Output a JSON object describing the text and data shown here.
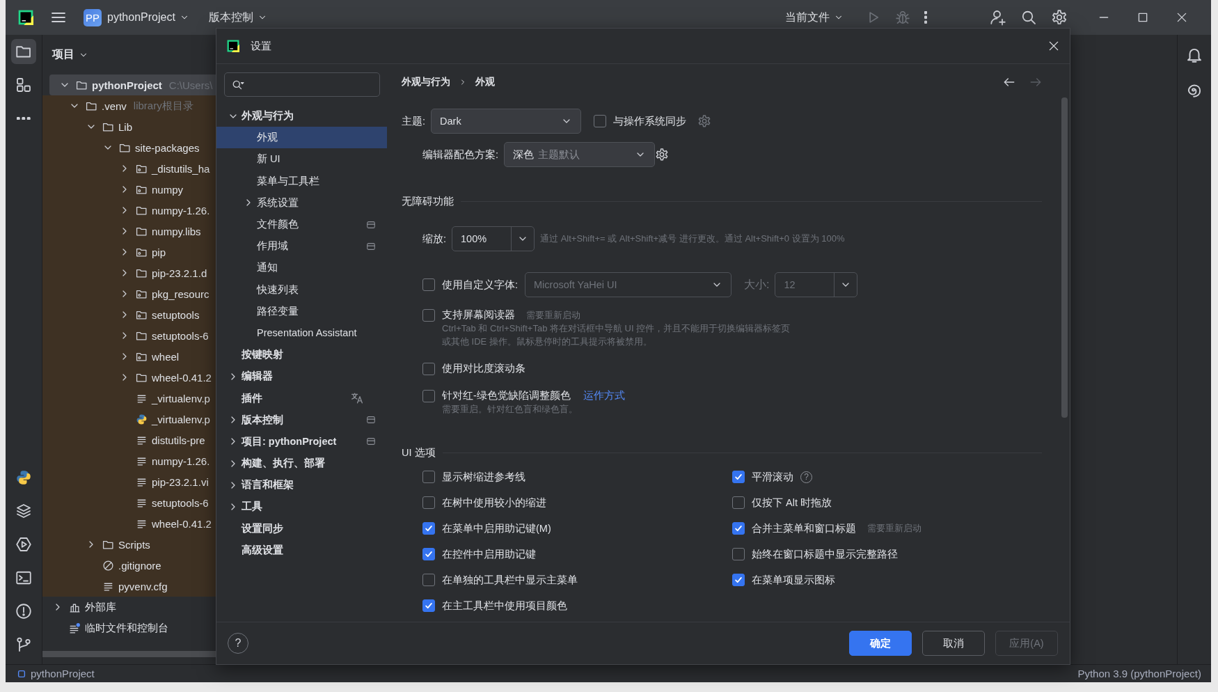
{
  "title_bar": {
    "project_badge": "PP",
    "project": "pythonProject",
    "vcs": "版本控制",
    "run_config": "当前文件",
    "run_disabled": true
  },
  "tool_strip": [
    {
      "kind": "folder",
      "selected": true
    },
    {
      "kind": "structure",
      "selected": false
    },
    {
      "kind": "more",
      "selected": false
    }
  ],
  "tool_strip_bottom": [
    {
      "kind": "python",
      "selected": false
    },
    {
      "kind": "layers",
      "selected": false
    },
    {
      "kind": "run",
      "selected": false
    },
    {
      "kind": "terminal",
      "selected": false
    },
    {
      "kind": "problems",
      "selected": false
    },
    {
      "kind": "git",
      "selected": false
    }
  ],
  "project_panel": {
    "title": "项目",
    "tree": [
      {
        "kind": "project",
        "name": "pythonProject",
        "hint": "C:\\Users\\",
        "selected": true,
        "excluded": false,
        "expanded": true,
        "children": [
          {
            "kind": "folder",
            "name": ".venv",
            "hint": "library根目录",
            "selected": false,
            "excluded": true,
            "expanded": true,
            "children": [
              {
                "kind": "folder",
                "name": "Lib",
                "selected": false,
                "excluded": true,
                "expanded": true,
                "children": [
                  {
                    "kind": "folder",
                    "name": "site-packages",
                    "selected": false,
                    "excluded": true,
                    "expanded": true,
                    "children": [
                      {
                        "kind": "package",
                        "name": "_distutils_ha",
                        "selected": false,
                        "excluded": true,
                        "expanded": false
                      },
                      {
                        "kind": "package",
                        "name": "numpy",
                        "selected": false,
                        "excluded": true,
                        "expanded": false
                      },
                      {
                        "kind": "folder",
                        "name": "numpy-1.26.",
                        "selected": false,
                        "excluded": true,
                        "expanded": false
                      },
                      {
                        "kind": "folder",
                        "name": "numpy.libs",
                        "selected": false,
                        "excluded": true,
                        "expanded": false
                      },
                      {
                        "kind": "package",
                        "name": "pip",
                        "selected": false,
                        "excluded": true,
                        "expanded": false
                      },
                      {
                        "kind": "folder",
                        "name": "pip-23.2.1.d",
                        "selected": false,
                        "excluded": true,
                        "expanded": false
                      },
                      {
                        "kind": "package",
                        "name": "pkg_resourc",
                        "selected": false,
                        "excluded": true,
                        "expanded": false
                      },
                      {
                        "kind": "package",
                        "name": "setuptools",
                        "selected": false,
                        "excluded": true,
                        "expanded": false
                      },
                      {
                        "kind": "folder",
                        "name": "setuptools-6",
                        "selected": false,
                        "excluded": true,
                        "expanded": false
                      },
                      {
                        "kind": "package",
                        "name": "wheel",
                        "selected": false,
                        "excluded": true,
                        "expanded": false
                      },
                      {
                        "kind": "folder",
                        "name": "wheel-0.41.2",
                        "selected": false,
                        "excluded": true,
                        "expanded": false
                      },
                      {
                        "kind": "text",
                        "name": "_virtualenv.p",
                        "selected": false,
                        "excluded": true
                      },
                      {
                        "kind": "python",
                        "name": "_virtualenv.p",
                        "selected": false,
                        "excluded": true
                      },
                      {
                        "kind": "text",
                        "name": "distutils-pre",
                        "selected": false,
                        "excluded": true
                      },
                      {
                        "kind": "text",
                        "name": "numpy-1.26.",
                        "selected": false,
                        "excluded": true
                      },
                      {
                        "kind": "text",
                        "name": "pip-23.2.1.vi",
                        "selected": false,
                        "excluded": true
                      },
                      {
                        "kind": "text",
                        "name": "setuptools-6",
                        "selected": false,
                        "excluded": true
                      },
                      {
                        "kind": "text",
                        "name": "wheel-0.41.2",
                        "selected": false,
                        "excluded": true
                      }
                    ]
                  }
                ]
              },
              {
                "kind": "folder",
                "name": "Scripts",
                "selected": false,
                "excluded": true,
                "expanded": false
              },
              {
                "kind": "ignore",
                "name": ".gitignore",
                "selected": false,
                "excluded": true
              },
              {
                "kind": "text",
                "name": "pyvenv.cfg",
                "selected": false,
                "excluded": true
              }
            ]
          }
        ]
      },
      {
        "kind": "library",
        "name": "外部库",
        "selected": false,
        "excluded": false,
        "expanded": false
      },
      {
        "kind": "scratch",
        "name": "临时文件和控制台",
        "selected": false,
        "excluded": false
      }
    ]
  },
  "right_strip": [
    {
      "kind": "bell"
    },
    {
      "kind": "spiral"
    }
  ],
  "status_bar": {
    "project": "pythonProject",
    "interpreter": "Python 3.9 (pythonProject)"
  },
  "settings_dialog": {
    "title": "设置",
    "nav": [
      {
        "label": "外观与行为",
        "selected": false,
        "expanded": true,
        "children": [
          {
            "label": "外观",
            "selected": true
          },
          {
            "label": "新 UI",
            "selected": false
          },
          {
            "label": "菜单与工具栏",
            "selected": false
          },
          {
            "label": "系统设置",
            "selected": false,
            "expanded": false
          },
          {
            "label": "文件颜色",
            "selected": false,
            "scoped": true
          },
          {
            "label": "作用域",
            "selected": false,
            "scoped": true
          },
          {
            "label": "通知",
            "selected": false
          },
          {
            "label": "快速列表",
            "selected": false
          },
          {
            "label": "路径变量",
            "selected": false
          },
          {
            "label": "Presentation Assistant",
            "selected": false
          }
        ]
      },
      {
        "label": "按键映射",
        "selected": false
      },
      {
        "label": "编辑器",
        "selected": false,
        "expanded": false
      },
      {
        "label": "插件",
        "selected": false,
        "translated": true
      },
      {
        "label": "版本控制",
        "selected": false,
        "expanded": false,
        "scoped": true
      },
      {
        "label": "项目: pythonProject",
        "selected": false,
        "expanded": false,
        "scoped": true
      },
      {
        "label": "构建、执行、部署",
        "selected": false,
        "expanded": false
      },
      {
        "label": "语言和框架",
        "selected": false,
        "expanded": false
      },
      {
        "label": "工具",
        "selected": false,
        "expanded": false
      },
      {
        "label": "设置同步",
        "selected": false
      },
      {
        "label": "高级设置",
        "selected": false
      }
    ],
    "breadcrumb": [
      "外观与行为",
      "外观"
    ],
    "back": {
      "disabled": false
    },
    "forward": {
      "disabled": true
    },
    "theme": {
      "label": "主题:",
      "value": "Dark",
      "sync": {
        "label": "与操作系统同步",
        "checked": false
      }
    },
    "scheme": {
      "label": "编辑器配色方案:",
      "value": "深色",
      "hint": "主题默认"
    },
    "accessibility": {
      "title": "无障碍功能",
      "rows": [
        {
          "kind": "zoom",
          "label": "缩放:",
          "value": "100%",
          "hint": "通过 Alt+Shift+= 或 Alt+Shift+减号 进行更改。通过 Alt+Shift+0 设置为 100%"
        },
        {
          "kind": "font",
          "checked": false,
          "label": "使用自定义字体:",
          "font": "Microsoft YaHei UI",
          "size_label": "大小:",
          "size": "12",
          "disabled": true
        },
        {
          "kind": "check",
          "checked": false,
          "label": "支持屏幕阅读器",
          "note": "需要重新启动",
          "description": [
            "Ctrl+Tab 和 Ctrl+Shift+Tab 将在对话框中导航 UI 控件，并且不能用于切换编辑器标签页",
            "或其他 IDE 操作。鼠标悬停时的工具提示将被禁用。"
          ]
        },
        {
          "kind": "check",
          "checked": false,
          "label": "使用对比度滚动条"
        },
        {
          "kind": "check",
          "checked": false,
          "label": "针对红-绿色觉缺陷调整颜色",
          "link": "运作方式",
          "description": [
            "需要重启。针对红色盲和绿色盲。"
          ]
        }
      ]
    },
    "ui_options": {
      "title": "UI 选项",
      "columns": [
        [
          {
            "label": "显示树缩进参考线",
            "checked": false
          },
          {
            "label": "在树中使用较小的缩进",
            "checked": false
          },
          {
            "label": "在菜单中启用助记键(M)",
            "checked": true
          },
          {
            "label": "在控件中启用助记键",
            "checked": true
          },
          {
            "label": "在单独的工具栏中显示主菜单",
            "checked": false
          },
          {
            "label": "在主工具栏中使用项目颜色",
            "checked": true
          }
        ],
        [
          {
            "label": "平滑滚动",
            "checked": true,
            "help": "?"
          },
          {
            "label": "仅按下 Alt 时拖放",
            "checked": false
          },
          {
            "label": "合并主菜单和窗口标题",
            "checked": true,
            "note": "需要重新启动"
          },
          {
            "label": "始终在窗口标题中显示完整路径",
            "checked": false
          },
          {
            "label": "在菜单项显示图标",
            "checked": true
          }
        ]
      ]
    },
    "footer": {
      "help": "?",
      "ok": "确定",
      "cancel": "取消",
      "apply": {
        "label": "应用(A)",
        "disabled": true
      }
    }
  }
}
